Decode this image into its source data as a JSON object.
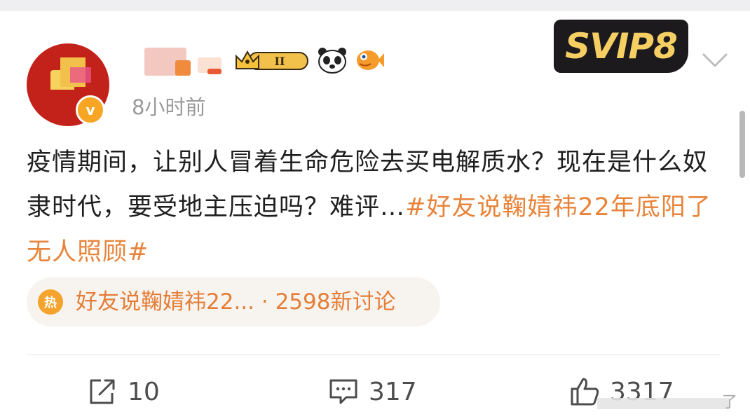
{
  "post": {
    "timestamp": "8小时前",
    "text_prefix": "疫情期间，让别人冒着生命危险去买电解质水？现在是什么奴隶时代，要受地主压迫吗？难评…",
    "hashtag": "#好友说鞠婧祎22年底阳了无人照顾#",
    "topic_icon": "热",
    "topic_label": "好友说鞠婧祎22...",
    "topic_separator": " · ",
    "topic_count": "2598新讨论"
  },
  "badges": {
    "svip_label": "SVIP8",
    "level_label": "II",
    "verified_label": "v"
  },
  "actions": {
    "share_count": "10",
    "comment_count": "317",
    "like_count": "3317"
  },
  "watermark": {
    "text": "了"
  },
  "colors": {
    "hashtag": "#e8843a",
    "topic_bg": "#f7f4ef",
    "text": "#1f1f1f",
    "meta": "#9a9a9a"
  },
  "icons": [
    "crown-level-icon",
    "panda-icon",
    "fish-icon",
    "chevron-down-icon",
    "share-icon",
    "comment-icon",
    "like-icon",
    "fire-icon"
  ]
}
